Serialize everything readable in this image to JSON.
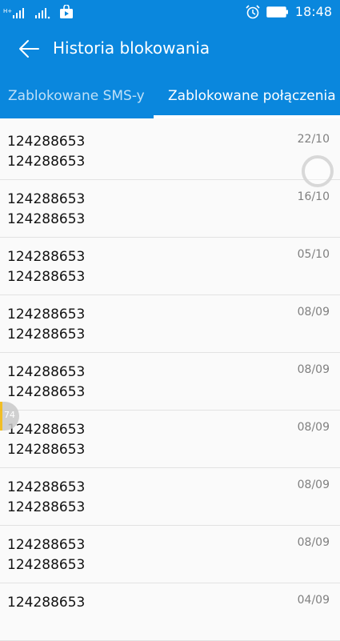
{
  "status_bar": {
    "time": "18:48",
    "icons": [
      "signal-icon",
      "signal-icon",
      "bag-icon",
      "alarm-icon",
      "battery-icon"
    ]
  },
  "app_bar": {
    "title": "Historia blokowania"
  },
  "tabs": [
    {
      "label": "Zablokowane SMS-y",
      "selected": false
    },
    {
      "label": "Zablokowane połączenia",
      "selected": true
    }
  ],
  "entries": [
    {
      "line1": "124288653",
      "line2": "124288653",
      "date": "22/10"
    },
    {
      "line1": "124288653",
      "line2": "124288653",
      "date": "16/10"
    },
    {
      "line1": "124288653",
      "line2": "124288653",
      "date": "05/10"
    },
    {
      "line1": "124288653",
      "line2": "124288653",
      "date": "08/09"
    },
    {
      "line1": "124288653",
      "line2": "124288653",
      "date": "08/09"
    },
    {
      "line1": "124288653",
      "line2": "124288653",
      "date": "08/09"
    },
    {
      "line1": "124288653",
      "line2": "124288653",
      "date": "08/09"
    },
    {
      "line1": "124288653",
      "line2": "124288653",
      "date": "08/09"
    },
    {
      "line1": "124288653",
      "line2": "",
      "date": "04/09"
    }
  ],
  "edge_badge": {
    "text": "74"
  },
  "colors": {
    "primary": "#0a87dd",
    "background": "#fafafa",
    "divider": "#e2e2e2",
    "date_text": "#808080"
  }
}
